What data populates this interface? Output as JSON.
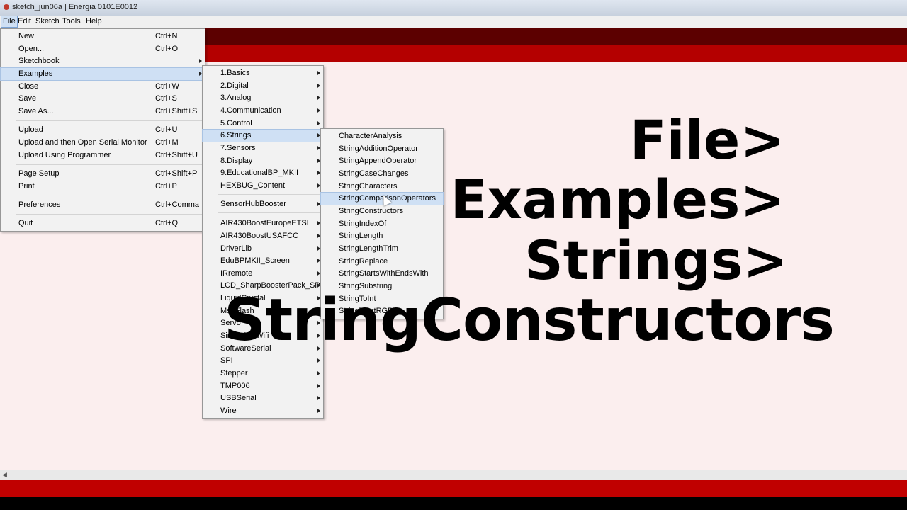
{
  "window": {
    "title": "sketch_jun06a | Energia 0101E0012"
  },
  "menubar": {
    "items": [
      "File",
      "Edit",
      "Sketch",
      "Tools",
      "Help"
    ],
    "active": "File"
  },
  "file_menu": {
    "items": [
      {
        "label": "New",
        "shortcut": "Ctrl+N"
      },
      {
        "label": "Open...",
        "shortcut": "Ctrl+O"
      },
      {
        "label": "Sketchbook",
        "shortcut": ""
      },
      {
        "label": "Examples",
        "shortcut": ""
      },
      {
        "label": "Close",
        "shortcut": "Ctrl+W"
      },
      {
        "label": "Save",
        "shortcut": "Ctrl+S"
      },
      {
        "label": "Save As...",
        "shortcut": "Ctrl+Shift+S"
      },
      {
        "label": "Upload",
        "shortcut": "Ctrl+U"
      },
      {
        "label": "Upload and then Open Serial Monitor",
        "shortcut": "Ctrl+M"
      },
      {
        "label": "Upload Using Programmer",
        "shortcut": "Ctrl+Shift+U"
      },
      {
        "label": "Page Setup",
        "shortcut": "Ctrl+Shift+P"
      },
      {
        "label": "Print",
        "shortcut": "Ctrl+P"
      },
      {
        "label": "Preferences",
        "shortcut": "Ctrl+Comma"
      },
      {
        "label": "Quit",
        "shortcut": "Ctrl+Q"
      }
    ]
  },
  "examples_menu": {
    "items": [
      "1.Basics",
      "2.Digital",
      "3.Analog",
      "4.Communication",
      "5.Control",
      "6.Strings",
      "7.Sensors",
      "8.Display",
      "9.EducationalBP_MKII",
      "HEXBUG_Content",
      "SensorHubBooster",
      "AIR430BoostEuropeETSI",
      "AIR430BoostUSAFCC",
      "DriverLib",
      "EduBPMKII_Screen",
      "IRremote",
      "LCD_SharpBoosterPack_SPI",
      "LiquidCrystal",
      "MspFlash",
      "Servo",
      "SimplelinkWifi",
      "SoftwareSerial",
      "SPI",
      "Stepper",
      "TMP006",
      "USBSerial",
      "Wire"
    ]
  },
  "strings_menu": {
    "items": [
      "CharacterAnalysis",
      "StringAdditionOperator",
      "StringAppendOperator",
      "StringCaseChanges",
      "StringCharacters",
      "StringComparisonOperators",
      "StringConstructors",
      "StringIndexOf",
      "StringLength",
      "StringLengthTrim",
      "StringReplace",
      "StringStartsWithEndsWith",
      "StringSubstring",
      "StringToInt",
      "StringToIntRGB"
    ]
  },
  "overlay": {
    "line1": "File>",
    "line2": "Examples>",
    "line3": "Strings>",
    "line4": "StringConstructors"
  },
  "colors": {
    "toolbar": "#5c0000",
    "tabbar": "#b40000",
    "editor": "#fbeeee",
    "statusbar": "#c00000",
    "menu_highlight": "#cfe0f4"
  }
}
